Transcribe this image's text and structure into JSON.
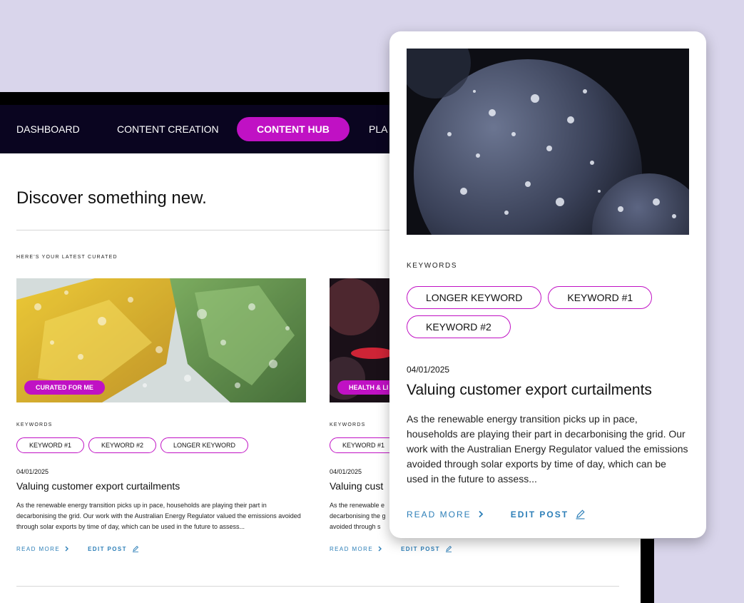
{
  "nav": {
    "items": [
      "DASHBOARD",
      "CONTENT CREATION",
      "CONTENT HUB",
      "PLA"
    ],
    "active_index": 2
  },
  "page": {
    "heading": "Discover something new.",
    "eyebrow": "HERE'S YOUR LATEST CURATED"
  },
  "cards": [
    {
      "badge": "CURATED FOR ME",
      "keywords_label": "KEYWORDS",
      "tags": [
        "KEYWORD #1",
        "KEYWORD #2",
        "LONGER KEYWORD"
      ],
      "date": "04/01/2025",
      "title": "Valuing customer export curtailments",
      "excerpt": "As the renewable energy transition picks up in pace, households are playing their part in decarbonising the grid. Our work with the Australian Energy Regulator valued the emissions avoided through solar exports by time of day, which can be used in the future to assess...",
      "read_more": "READ MORE",
      "edit_post": "EDIT POST"
    },
    {
      "badge": "HEALTH & LI",
      "keywords_label": "KEYWORDS",
      "tags": [
        "KEYWORD #1"
      ],
      "date": "04/01/2025",
      "title": "Valuing cust",
      "excerpt_lines": [
        "As the renewable e",
        "decarbonising the g",
        "avoided through s"
      ],
      "read_more": "READ MORE",
      "edit_post": "EDIT POST"
    }
  ],
  "popup": {
    "keywords_label": "KEYWORDS",
    "tags": [
      "LONGER KEYWORD",
      "KEYWORD #1",
      "KEYWORD #2"
    ],
    "date": "04/01/2025",
    "title": "Valuing customer export curtailments",
    "excerpt": "As the renewable energy transition picks up in pace, households are playing their part in decarbonising the grid. Our work with the Australian Energy Regulator valued the emissions avoided through solar exports by time of day, which can be used in the future to assess...",
    "read_more": "READ MORE",
    "edit_post": "EDIT POST"
  },
  "colors": {
    "accent": "#c011c4",
    "link": "#2d7fb8",
    "nav_bg": "#0a0520",
    "backdrop": "#d9d5eb"
  },
  "icons": {
    "read_more": "chevron-right-icon",
    "edit_post": "pencil-icon"
  }
}
